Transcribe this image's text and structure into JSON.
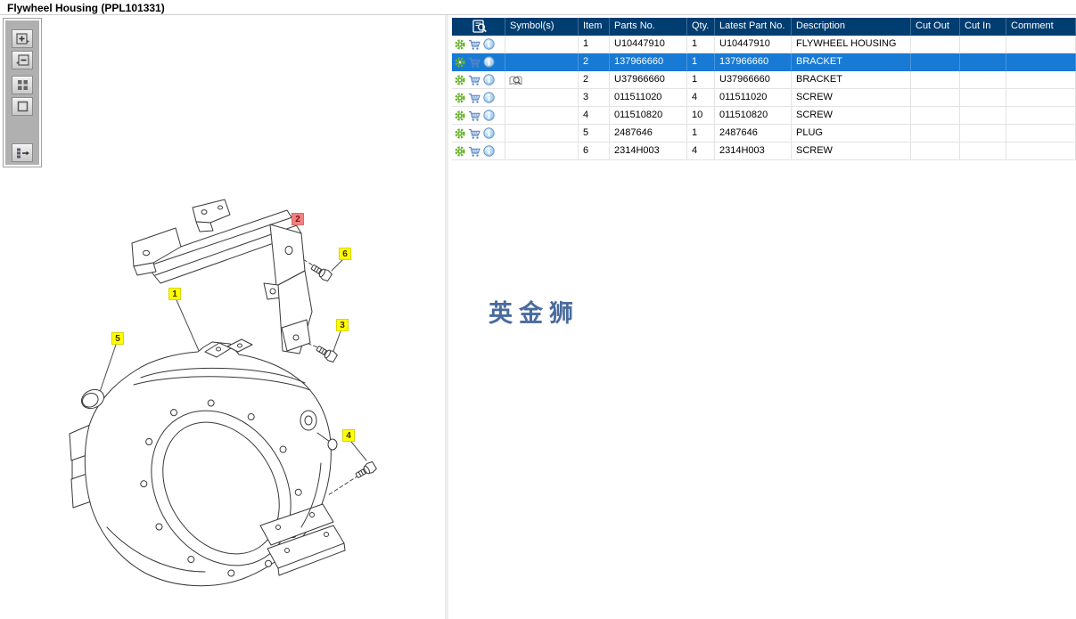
{
  "window": {
    "title": "Flywheel Housing (PPL101331)"
  },
  "toolbar": {
    "buttons": [
      {
        "name": "zoom-in",
        "icon": "plus-box-icon"
      },
      {
        "name": "zoom-out",
        "icon": "minus-box-icon"
      },
      {
        "name": "tile-view",
        "icon": "four-squares-icon"
      },
      {
        "name": "fit-view",
        "icon": "square-outline-icon"
      },
      {
        "name": "toggle-parts-list",
        "icon": "list-arrow-icon"
      }
    ]
  },
  "watermark": "英金狮",
  "drawing": {
    "callouts": [
      {
        "label": "1",
        "selected": false
      },
      {
        "label": "2",
        "selected": true
      },
      {
        "label": "3",
        "selected": false
      },
      {
        "label": "4",
        "selected": false
      },
      {
        "label": "5",
        "selected": false
      },
      {
        "label": "6",
        "selected": false
      }
    ]
  },
  "table": {
    "headers": {
      "preview": "",
      "symbols": "Symbol(s)",
      "item": "Item",
      "parts_no": "Parts No.",
      "qty": "Qty.",
      "latest_part_no": "Latest Part No.",
      "description": "Description",
      "cut_out": "Cut Out",
      "cut_in": "Cut In",
      "comment": "Comment"
    },
    "row_icons": [
      "gear-icon",
      "cart-icon",
      "info-icon"
    ],
    "rows": [
      {
        "item": "1",
        "parts_no": "U10447910",
        "qty": "1",
        "latest_part_no": "U10447910",
        "description": "FLYWHEEL HOUSING",
        "cut_out": "",
        "cut_in": "",
        "comment": "",
        "selected": false,
        "has_symbol": false
      },
      {
        "item": "2",
        "parts_no": "137966660",
        "qty": "1",
        "latest_part_no": "137966660",
        "description": "BRACKET",
        "cut_out": "",
        "cut_in": "",
        "comment": "",
        "selected": true,
        "has_symbol": false
      },
      {
        "item": "2",
        "parts_no": "U37966660",
        "qty": "1",
        "latest_part_no": "U37966660",
        "description": "BRACKET",
        "cut_out": "",
        "cut_in": "",
        "comment": "",
        "selected": false,
        "has_symbol": true
      },
      {
        "item": "3",
        "parts_no": "011511020",
        "qty": "4",
        "latest_part_no": "011511020",
        "description": "SCREW",
        "cut_out": "",
        "cut_in": "",
        "comment": "",
        "selected": false,
        "has_symbol": false
      },
      {
        "item": "4",
        "parts_no": "011510820",
        "qty": "10",
        "latest_part_no": "011510820",
        "description": "SCREW",
        "cut_out": "",
        "cut_in": "",
        "comment": "",
        "selected": false,
        "has_symbol": false
      },
      {
        "item": "5",
        "parts_no": "2487646",
        "qty": "1",
        "latest_part_no": "2487646",
        "description": "PLUG",
        "cut_out": "",
        "cut_in": "",
        "comment": "",
        "selected": false,
        "has_symbol": false
      },
      {
        "item": "6",
        "parts_no": "2314H003",
        "qty": "4",
        "latest_part_no": "2314H003",
        "description": "SCREW",
        "cut_out": "",
        "cut_in": "",
        "comment": "",
        "selected": false,
        "has_symbol": false
      }
    ]
  },
  "colors": {
    "header_bg": "#003d71",
    "selected_row_bg": "#187ad4",
    "callout_bg": "#ffff00",
    "callout_selected_bg": "#f28080",
    "watermark": "#4a6b9f",
    "gear_icon": "#67b32a",
    "cart_icon": "#5b87c5",
    "info_icon": "#6699cc"
  }
}
